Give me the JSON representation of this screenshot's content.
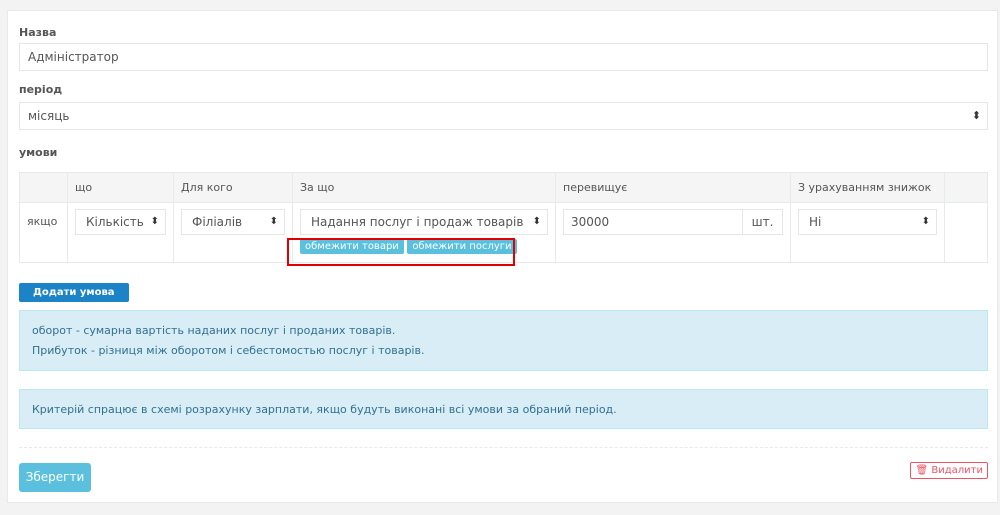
{
  "form": {
    "name_label": "Назва",
    "name_value": "Адміністратор",
    "period_label": "період",
    "period_value": "місяць",
    "conditions_label": "умови"
  },
  "table": {
    "headers": [
      "",
      "що",
      "Для кого",
      "За що",
      "перевищує",
      "З урахуванням знижок",
      ""
    ],
    "row": {
      "prefix": "якщо",
      "what": "Кількість",
      "for_whom": "Філіалів",
      "for_what": "Надання послуг і продаж товарів",
      "exceeds_value": "30000",
      "unit": "шт.",
      "discounts": "Ні",
      "limit_goods": "обмежити товари",
      "limit_services": "обмежити послуги"
    }
  },
  "buttons": {
    "add_condition": "Додати умова",
    "save": "Зберегти",
    "delete": "Видалити"
  },
  "info": {
    "line1": "оборот - сумарна вартість наданих послуг і проданих товарів.",
    "line2": "Прибуток - різниця між оборотом і себестомостью послуг і товарів.",
    "note": "Критерій спрацює в схемі розрахунку зарплати, якщо будуть виконані всі умови за обраний період."
  },
  "icons": {
    "select_arrow": "sort-arrows-icon",
    "delete": "trash-icon"
  },
  "colors": {
    "info_bg": "#d9edf7",
    "primary": "#1c84c6",
    "info_btn": "#5bc0de",
    "danger": "#ed5565",
    "highlight": "#e00000"
  }
}
